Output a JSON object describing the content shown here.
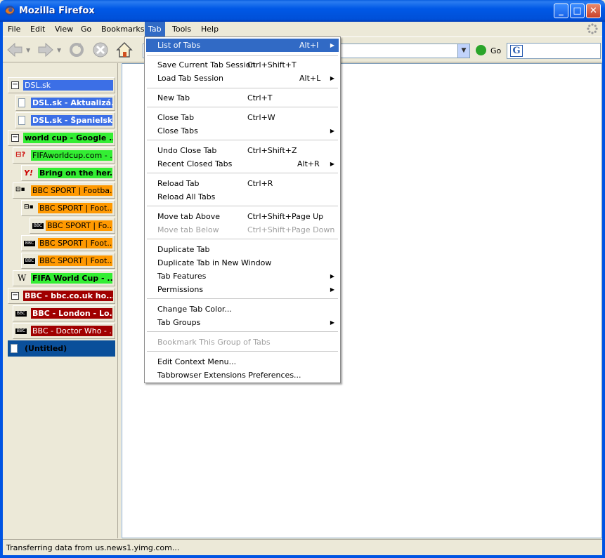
{
  "window": {
    "title": "Mozilla Firefox"
  },
  "menubar": [
    {
      "label": "File"
    },
    {
      "label": "Edit"
    },
    {
      "label": "View"
    },
    {
      "label": "Go"
    },
    {
      "label": "Bookmarks"
    },
    {
      "label": "Tab"
    },
    {
      "label": "Tools"
    },
    {
      "label": "Help"
    }
  ],
  "toolbar": {
    "go_label": "Go",
    "url_value": ""
  },
  "sidebar_tabs": [
    {
      "label": "DSL.sk",
      "color": "#3c6fe6",
      "text_color": "#ffffff",
      "icon": "collapse-icon",
      "bold": false
    },
    {
      "label": "DSL.sk - Aktualizá...",
      "color": "#3c6fe6",
      "text_color": "#ffffff",
      "icon": "page-icon",
      "bold": true
    },
    {
      "label": "DSL.sk - Španielsk...",
      "color": "#3c6fe6",
      "text_color": "#ffffff",
      "icon": "page-icon",
      "bold": true
    },
    {
      "label": "world cup - Google ...",
      "color": "#33ee33",
      "text_color": "#000000",
      "icon": "collapse-icon",
      "bold": true
    },
    {
      "label": "FIFAworldcup.com - ...",
      "color": "#33ee33",
      "text_color": "#000000",
      "icon": "fifa-icon",
      "bold": false
    },
    {
      "label": "Bring on the her...",
      "color": "#33ee33",
      "text_color": "#000000",
      "icon": "yahoo-icon",
      "bold": true
    },
    {
      "label": "BBC SPORT | Footba...",
      "color": "#ff9900",
      "text_color": "#000000",
      "icon": "bbc-icon",
      "bold": false
    },
    {
      "label": "BBC SPORT | Foot...",
      "color": "#ff9900",
      "text_color": "#000000",
      "icon": "bbc-icon",
      "bold": false
    },
    {
      "label": "BBC SPORT | Fo...",
      "color": "#ff9900",
      "text_color": "#000000",
      "icon": "bbc-icon",
      "bold": false
    },
    {
      "label": "BBC SPORT | Foot...",
      "color": "#ff9900",
      "text_color": "#000000",
      "icon": "bbc-icon",
      "bold": false
    },
    {
      "label": "BBC SPORT | Foot...",
      "color": "#ff9900",
      "text_color": "#000000",
      "icon": "bbc-icon",
      "bold": false
    },
    {
      "label": "FIFA World Cup - ...",
      "color": "#33ee33",
      "text_color": "#000000",
      "icon": "wikipedia-icon",
      "bold": true
    },
    {
      "label": "BBC - bbc.co.uk ho...",
      "color": "#a00000",
      "text_color": "#ffffff",
      "icon": "collapse-icon",
      "bold": true
    },
    {
      "label": "BBC - London - Lo...",
      "color": "#a00000",
      "text_color": "#ffffff",
      "icon": "bbc-icon",
      "bold": true
    },
    {
      "label": "BBC - Doctor Who - ...",
      "color": "#a00000",
      "text_color": "#ffffff",
      "icon": "bbc-icon",
      "bold": false
    },
    {
      "label": "(Untitled)",
      "color": "#0a4f9a",
      "text_color": "#000000",
      "icon": "page-icon",
      "bold": true
    }
  ],
  "tab_menu": {
    "items": [
      {
        "label": "List of Tabs",
        "shortcut": "Alt+I",
        "submenu": true,
        "highlighted": true,
        "disabled": false
      },
      {
        "label": "Save Current Tab Session",
        "shortcut": "Ctrl+Shift+T",
        "submenu": false,
        "highlighted": false,
        "disabled": false
      },
      {
        "label": "Load Tab Session",
        "shortcut": "Alt+L",
        "submenu": true,
        "highlighted": false,
        "disabled": false
      },
      {
        "label": "New Tab",
        "shortcut": "Ctrl+T",
        "submenu": false,
        "highlighted": false,
        "disabled": false
      },
      {
        "label": "Close Tab",
        "shortcut": "Ctrl+W",
        "submenu": false,
        "highlighted": false,
        "disabled": false
      },
      {
        "label": "Close Tabs",
        "shortcut": "",
        "submenu": true,
        "highlighted": false,
        "disabled": false
      },
      {
        "label": "Undo Close Tab",
        "shortcut": "Ctrl+Shift+Z",
        "submenu": false,
        "highlighted": false,
        "disabled": false
      },
      {
        "label": "Recent Closed Tabs",
        "shortcut": "Alt+R",
        "submenu": true,
        "highlighted": false,
        "disabled": false
      },
      {
        "label": "Reload Tab",
        "shortcut": "Ctrl+R",
        "submenu": false,
        "highlighted": false,
        "disabled": false
      },
      {
        "label": "Reload All Tabs",
        "shortcut": "",
        "submenu": false,
        "highlighted": false,
        "disabled": false
      },
      {
        "label": "Move tab Above",
        "shortcut": "Ctrl+Shift+Page Up",
        "submenu": false,
        "highlighted": false,
        "disabled": false
      },
      {
        "label": "Move tab Below",
        "shortcut": "Ctrl+Shift+Page Down",
        "submenu": false,
        "highlighted": false,
        "disabled": true
      },
      {
        "label": "Duplicate Tab",
        "shortcut": "",
        "submenu": false,
        "highlighted": false,
        "disabled": false
      },
      {
        "label": "Duplicate Tab in New Window",
        "shortcut": "",
        "submenu": false,
        "highlighted": false,
        "disabled": false
      },
      {
        "label": "Tab Features",
        "shortcut": "",
        "submenu": true,
        "highlighted": false,
        "disabled": false
      },
      {
        "label": "Permissions",
        "shortcut": "",
        "submenu": true,
        "highlighted": false,
        "disabled": false
      },
      {
        "label": "Change Tab Color...",
        "shortcut": "",
        "submenu": false,
        "highlighted": false,
        "disabled": false
      },
      {
        "label": "Tab Groups",
        "shortcut": "",
        "submenu": true,
        "highlighted": false,
        "disabled": false
      },
      {
        "label": "Bookmark This Group of Tabs",
        "shortcut": "",
        "submenu": false,
        "highlighted": false,
        "disabled": true
      },
      {
        "label": "Edit Context Menu...",
        "shortcut": "",
        "submenu": false,
        "highlighted": false,
        "disabled": false
      },
      {
        "label": "Tabbrowser Extensions Preferences...",
        "shortcut": "",
        "submenu": false,
        "highlighted": false,
        "disabled": false
      }
    ]
  },
  "statusbar": {
    "text": "Transferring data from us.news1.yimg.com..."
  }
}
